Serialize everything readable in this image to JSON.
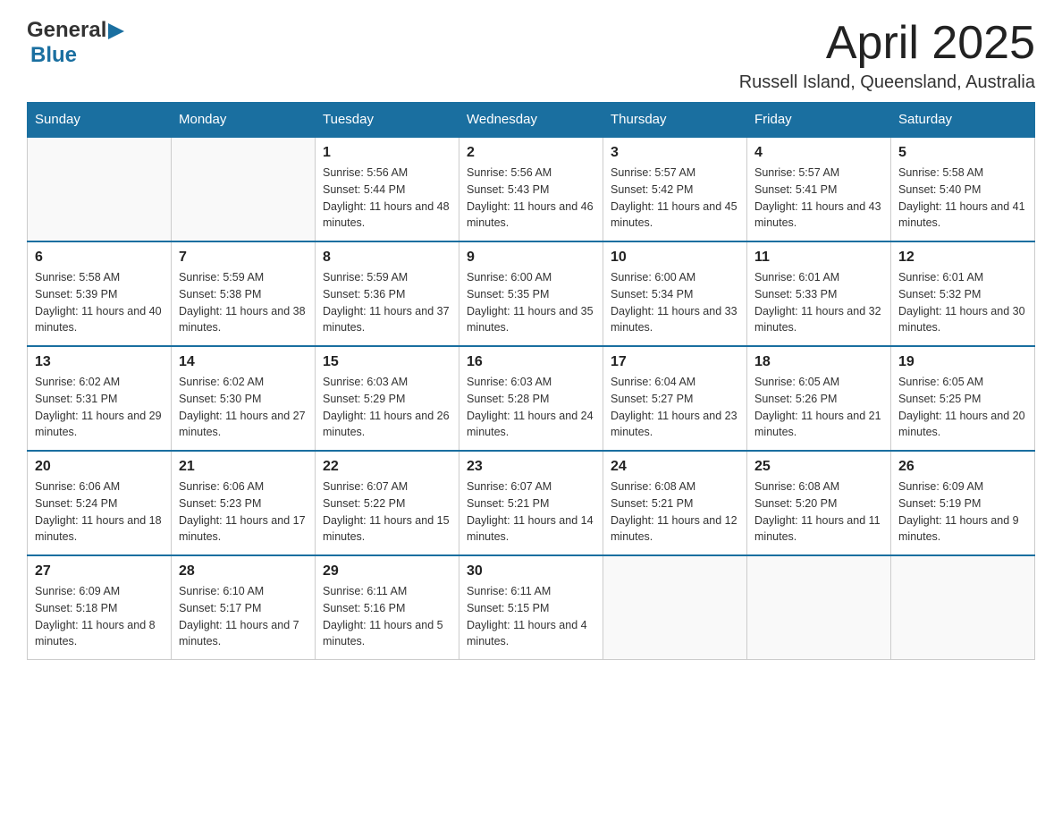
{
  "header": {
    "logo_general": "General",
    "logo_blue": "Blue",
    "month_year": "April 2025",
    "location": "Russell Island, Queensland, Australia"
  },
  "days_of_week": [
    "Sunday",
    "Monday",
    "Tuesday",
    "Wednesday",
    "Thursday",
    "Friday",
    "Saturday"
  ],
  "weeks": [
    [
      {
        "day": "",
        "sunrise": "",
        "sunset": "",
        "daylight": ""
      },
      {
        "day": "",
        "sunrise": "",
        "sunset": "",
        "daylight": ""
      },
      {
        "day": "1",
        "sunrise": "Sunrise: 5:56 AM",
        "sunset": "Sunset: 5:44 PM",
        "daylight": "Daylight: 11 hours and 48 minutes."
      },
      {
        "day": "2",
        "sunrise": "Sunrise: 5:56 AM",
        "sunset": "Sunset: 5:43 PM",
        "daylight": "Daylight: 11 hours and 46 minutes."
      },
      {
        "day": "3",
        "sunrise": "Sunrise: 5:57 AM",
        "sunset": "Sunset: 5:42 PM",
        "daylight": "Daylight: 11 hours and 45 minutes."
      },
      {
        "day": "4",
        "sunrise": "Sunrise: 5:57 AM",
        "sunset": "Sunset: 5:41 PM",
        "daylight": "Daylight: 11 hours and 43 minutes."
      },
      {
        "day": "5",
        "sunrise": "Sunrise: 5:58 AM",
        "sunset": "Sunset: 5:40 PM",
        "daylight": "Daylight: 11 hours and 41 minutes."
      }
    ],
    [
      {
        "day": "6",
        "sunrise": "Sunrise: 5:58 AM",
        "sunset": "Sunset: 5:39 PM",
        "daylight": "Daylight: 11 hours and 40 minutes."
      },
      {
        "day": "7",
        "sunrise": "Sunrise: 5:59 AM",
        "sunset": "Sunset: 5:38 PM",
        "daylight": "Daylight: 11 hours and 38 minutes."
      },
      {
        "day": "8",
        "sunrise": "Sunrise: 5:59 AM",
        "sunset": "Sunset: 5:36 PM",
        "daylight": "Daylight: 11 hours and 37 minutes."
      },
      {
        "day": "9",
        "sunrise": "Sunrise: 6:00 AM",
        "sunset": "Sunset: 5:35 PM",
        "daylight": "Daylight: 11 hours and 35 minutes."
      },
      {
        "day": "10",
        "sunrise": "Sunrise: 6:00 AM",
        "sunset": "Sunset: 5:34 PM",
        "daylight": "Daylight: 11 hours and 33 minutes."
      },
      {
        "day": "11",
        "sunrise": "Sunrise: 6:01 AM",
        "sunset": "Sunset: 5:33 PM",
        "daylight": "Daylight: 11 hours and 32 minutes."
      },
      {
        "day": "12",
        "sunrise": "Sunrise: 6:01 AM",
        "sunset": "Sunset: 5:32 PM",
        "daylight": "Daylight: 11 hours and 30 minutes."
      }
    ],
    [
      {
        "day": "13",
        "sunrise": "Sunrise: 6:02 AM",
        "sunset": "Sunset: 5:31 PM",
        "daylight": "Daylight: 11 hours and 29 minutes."
      },
      {
        "day": "14",
        "sunrise": "Sunrise: 6:02 AM",
        "sunset": "Sunset: 5:30 PM",
        "daylight": "Daylight: 11 hours and 27 minutes."
      },
      {
        "day": "15",
        "sunrise": "Sunrise: 6:03 AM",
        "sunset": "Sunset: 5:29 PM",
        "daylight": "Daylight: 11 hours and 26 minutes."
      },
      {
        "day": "16",
        "sunrise": "Sunrise: 6:03 AM",
        "sunset": "Sunset: 5:28 PM",
        "daylight": "Daylight: 11 hours and 24 minutes."
      },
      {
        "day": "17",
        "sunrise": "Sunrise: 6:04 AM",
        "sunset": "Sunset: 5:27 PM",
        "daylight": "Daylight: 11 hours and 23 minutes."
      },
      {
        "day": "18",
        "sunrise": "Sunrise: 6:05 AM",
        "sunset": "Sunset: 5:26 PM",
        "daylight": "Daylight: 11 hours and 21 minutes."
      },
      {
        "day": "19",
        "sunrise": "Sunrise: 6:05 AM",
        "sunset": "Sunset: 5:25 PM",
        "daylight": "Daylight: 11 hours and 20 minutes."
      }
    ],
    [
      {
        "day": "20",
        "sunrise": "Sunrise: 6:06 AM",
        "sunset": "Sunset: 5:24 PM",
        "daylight": "Daylight: 11 hours and 18 minutes."
      },
      {
        "day": "21",
        "sunrise": "Sunrise: 6:06 AM",
        "sunset": "Sunset: 5:23 PM",
        "daylight": "Daylight: 11 hours and 17 minutes."
      },
      {
        "day": "22",
        "sunrise": "Sunrise: 6:07 AM",
        "sunset": "Sunset: 5:22 PM",
        "daylight": "Daylight: 11 hours and 15 minutes."
      },
      {
        "day": "23",
        "sunrise": "Sunrise: 6:07 AM",
        "sunset": "Sunset: 5:21 PM",
        "daylight": "Daylight: 11 hours and 14 minutes."
      },
      {
        "day": "24",
        "sunrise": "Sunrise: 6:08 AM",
        "sunset": "Sunset: 5:21 PM",
        "daylight": "Daylight: 11 hours and 12 minutes."
      },
      {
        "day": "25",
        "sunrise": "Sunrise: 6:08 AM",
        "sunset": "Sunset: 5:20 PM",
        "daylight": "Daylight: 11 hours and 11 minutes."
      },
      {
        "day": "26",
        "sunrise": "Sunrise: 6:09 AM",
        "sunset": "Sunset: 5:19 PM",
        "daylight": "Daylight: 11 hours and 9 minutes."
      }
    ],
    [
      {
        "day": "27",
        "sunrise": "Sunrise: 6:09 AM",
        "sunset": "Sunset: 5:18 PM",
        "daylight": "Daylight: 11 hours and 8 minutes."
      },
      {
        "day": "28",
        "sunrise": "Sunrise: 6:10 AM",
        "sunset": "Sunset: 5:17 PM",
        "daylight": "Daylight: 11 hours and 7 minutes."
      },
      {
        "day": "29",
        "sunrise": "Sunrise: 6:11 AM",
        "sunset": "Sunset: 5:16 PM",
        "daylight": "Daylight: 11 hours and 5 minutes."
      },
      {
        "day": "30",
        "sunrise": "Sunrise: 6:11 AM",
        "sunset": "Sunset: 5:15 PM",
        "daylight": "Daylight: 11 hours and 4 minutes."
      },
      {
        "day": "",
        "sunrise": "",
        "sunset": "",
        "daylight": ""
      },
      {
        "day": "",
        "sunrise": "",
        "sunset": "",
        "daylight": ""
      },
      {
        "day": "",
        "sunrise": "",
        "sunset": "",
        "daylight": ""
      }
    ]
  ]
}
